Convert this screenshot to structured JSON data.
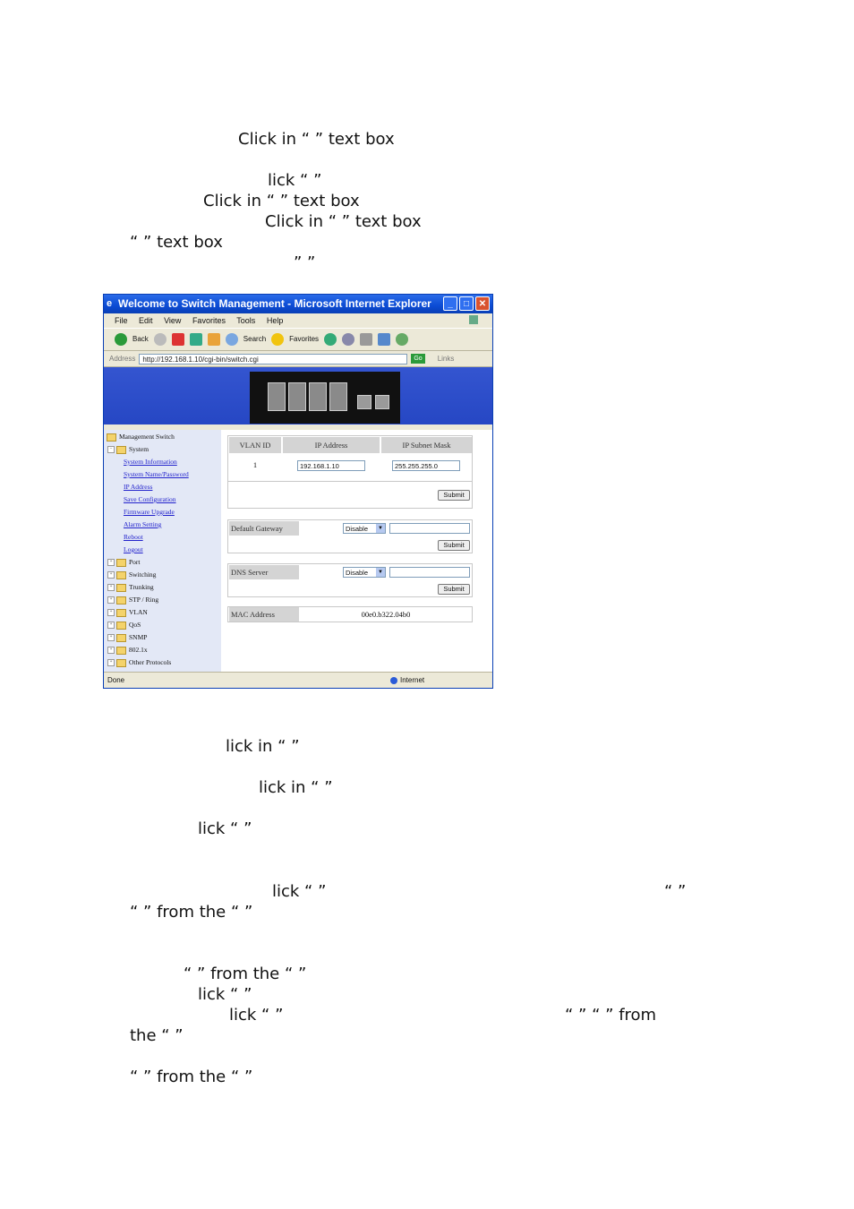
{
  "doc_fragments": {
    "l1": "Click  in  “                        ”  text  box",
    "l2": "lick “                            ”",
    "l3": "Click in “               ” text box",
    "l4": "Click  in  “                          ”  text  box",
    "l5": "“               ” text box",
    "l6": "”                          ”",
    "l7": "lick  in  “                ”",
    "l8": "lick in “                      ”",
    "l9": "lick “            ”",
    "l10a": "lick  “                          ”",
    "l10b": "“            ”",
    "l11": "“          ”  from  the  “                        ”",
    "l12": "“            ” from the “                       ”",
    "l13": "lick “            ”",
    "l14a": "lick “                  ”",
    "l14b": "“            ”   “            ” from",
    "l15": "the “                  ”",
    "l16": "“            ” from the “                ”"
  },
  "browser": {
    "title": "Welcome to Switch Management - Microsoft Internet Explorer",
    "menu": [
      "File",
      "Edit",
      "View",
      "Favorites",
      "Tools",
      "Help"
    ],
    "toolbar": {
      "back": "Back",
      "search": "Search",
      "favorites": "Favorites"
    },
    "address_label": "Address",
    "address_value": "http://192.168.1.10/cgi-bin/switch.cgi",
    "go": "Go",
    "links": "Links",
    "status_left": "Done",
    "status_right": "Internet"
  },
  "nav": {
    "root": "Management Switch",
    "system": "System",
    "items": [
      "System Information",
      "System Name/Password",
      "IP Address",
      "Save Configuration",
      "Firmware Upgrade",
      "Alarm Setting",
      "Reboot",
      "Logout"
    ],
    "folders": [
      "Port",
      "Switching",
      "Trunking",
      "STP / Ring",
      "VLAN",
      "QoS",
      "SNMP",
      "802.1x",
      "Other Protocols"
    ]
  },
  "ip_table": {
    "headers": [
      "VLAN ID",
      "IP Address",
      "IP Subnet Mask"
    ],
    "vlan_id": "1",
    "ip": "192.168.1.10",
    "mask": "255.255.255.0",
    "submit": "Submit"
  },
  "gateway": {
    "label": "Default Gateway",
    "select": "Disable",
    "submit": "Submit"
  },
  "dns": {
    "label": "DNS Server",
    "select": "Disable",
    "submit": "Submit"
  },
  "mac": {
    "label": "MAC Address",
    "value": "00e0.b322.04b0"
  }
}
